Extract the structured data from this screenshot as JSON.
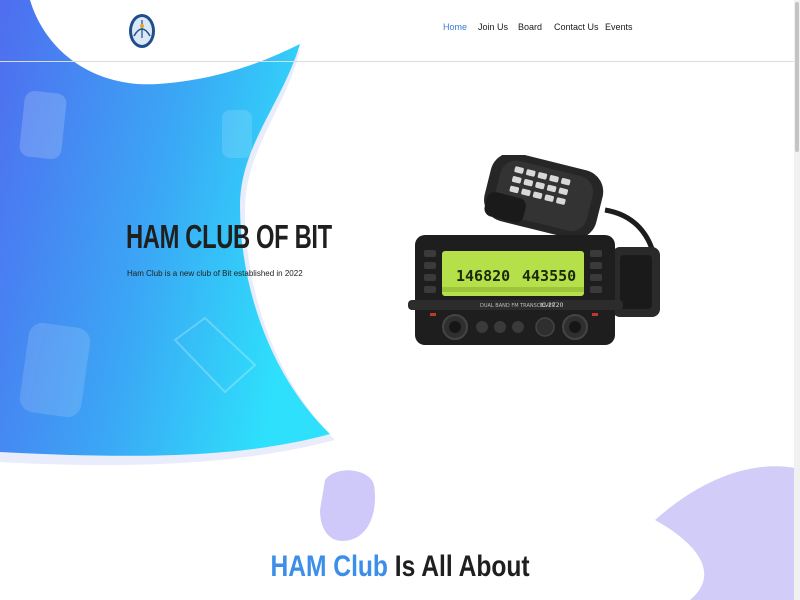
{
  "nav": {
    "items": [
      {
        "label": "Home",
        "active": true
      },
      {
        "label": "Join Us",
        "active": false
      },
      {
        "label": "Board",
        "active": false
      },
      {
        "label": "Contact Us",
        "active": false
      },
      {
        "label": "Events",
        "active": false
      }
    ]
  },
  "hero": {
    "title": "HAM CLUB OF BIT",
    "subtitle": "Ham Club is a new club of Bit established in 2022",
    "image_icon": "transceiver-radio-image",
    "radio_display_left": "146820",
    "radio_display_right": "443550",
    "radio_model": "IC-2720"
  },
  "section": {
    "heading_accent": "HAM Club",
    "heading_rest": " Is All About"
  },
  "colors": {
    "accent": "#3b8fe8",
    "nav_active": "#3a7bd5",
    "hero_gradient_start": "#4f6df0",
    "hero_gradient_end": "#2ee0fb",
    "lavender_shape": "#c9c3f7"
  }
}
